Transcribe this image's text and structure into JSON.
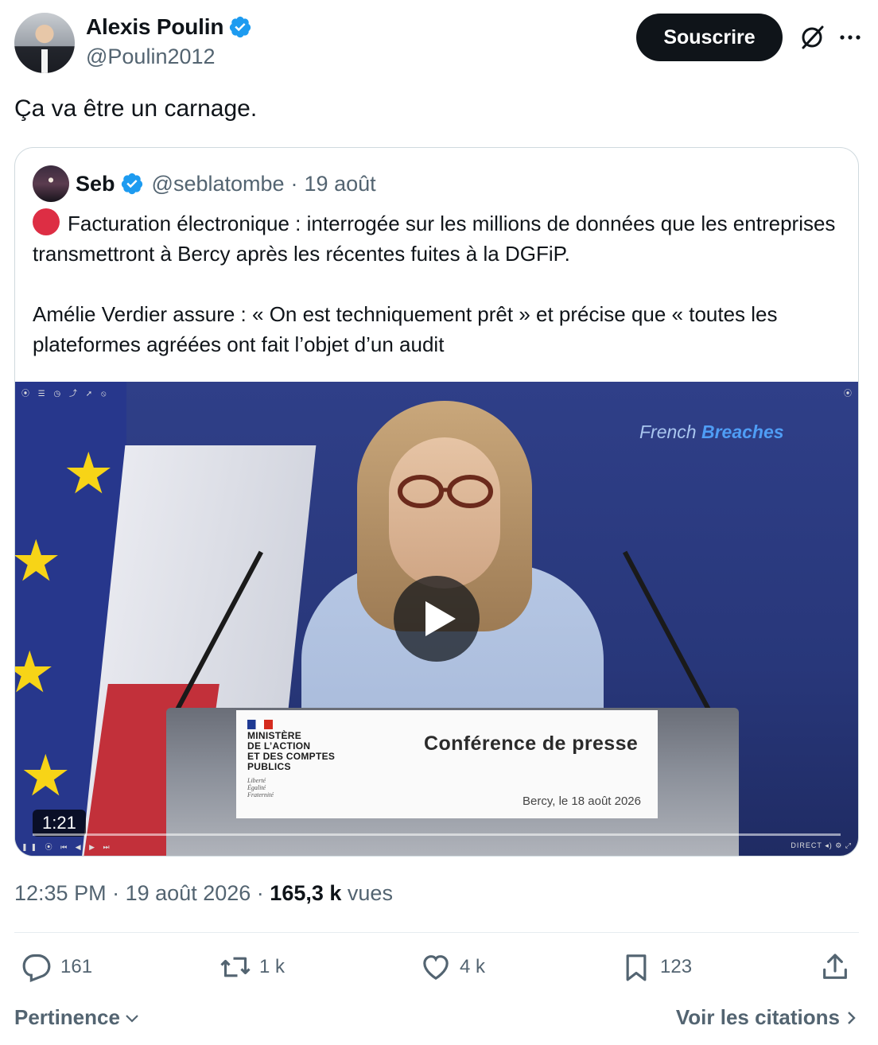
{
  "author": {
    "display_name": "Alexis Poulin",
    "handle": "@Poulin2012",
    "verified": true
  },
  "header": {
    "subscribe_label": "Souscrire",
    "grok_icon": "grok-icon",
    "more_icon": "more-icon"
  },
  "tweet": {
    "text": "Ça va être un carnage."
  },
  "quoted": {
    "display_name": "Seb",
    "handle": "@seblatombe",
    "separator": "·",
    "date": "19 août",
    "paragraph1": "Facturation électronique : interrogée sur les millions de données que les entreprises transmettront à Bercy après les récentes fuites à la DGFiP.",
    "paragraph2": "Amélie Verdier assure : « On est techniquement prêt » et précise que « toutes les plateformes agréées ont fait l’objet d’un audit",
    "video": {
      "watermark_part1": "French ",
      "watermark_part2": "Breaches",
      "ministry_lines": "MINISTÈRE\nDE L’ACTION\nET DES COMPTES\nPUBLICS",
      "motto": "Liberté\nÉgalité\nFraternité",
      "placard_title": "Conférence de presse",
      "placard_date": "Bercy, le 18 août 2026",
      "duration": "1:21",
      "live_label": "DIRECT"
    }
  },
  "meta": {
    "time": "12:35 PM",
    "sep": "·",
    "date": "19 août 2026",
    "sep2": "·",
    "views_count": "165,3 k",
    "views_label": "vues"
  },
  "actions": {
    "replies": "161",
    "reposts": "1 k",
    "likes": "4 k",
    "bookmarks": "123"
  },
  "footer": {
    "sort_label": "Pertinence",
    "quotes_link": "Voir les citations"
  },
  "colors": {
    "verified": "#1d9bf0",
    "secondary_text": "#536471",
    "primary_text": "#0f1419",
    "button_bg": "#0f1419",
    "red_circle": "#dd2e44"
  }
}
